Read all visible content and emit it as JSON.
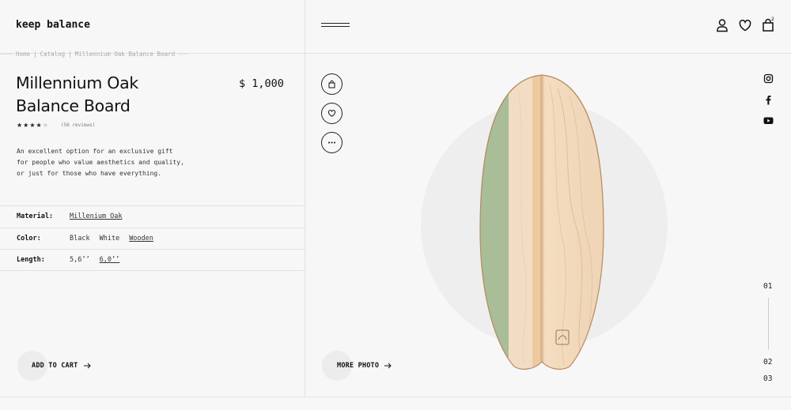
{
  "header": {
    "logo": "keep balance",
    "cart_count": "2",
    "icons": [
      "menu-icon",
      "user-icon",
      "heart-icon",
      "cart-icon"
    ]
  },
  "breadcrumb": {
    "items": [
      "Home",
      "Catalog",
      "Millennium Oak Balance Board"
    ],
    "separator": "|"
  },
  "product": {
    "title": "Millennium Oak Balance Board",
    "price": "$ 1,000",
    "rating": 4,
    "rating_max": 5,
    "reviews": "(56 reviews)",
    "description": [
      "An excellent option for an exclusive gift",
      "for people who value aesthetics and quality,",
      "or just for those who have everything."
    ]
  },
  "attributes": {
    "material": {
      "label": "Material:",
      "options": [
        "Millenium Oak"
      ],
      "selected": "Millenium Oak"
    },
    "color": {
      "label": "Color:",
      "options": [
        "Black",
        "White",
        "Wooden"
      ],
      "selected": "Wooden"
    },
    "length": {
      "label": "Length:",
      "options": [
        "5,6’’",
        "6,0’’"
      ],
      "selected": "6,0’’"
    }
  },
  "actions": {
    "add_to_cart": "ADD TO CART",
    "more_photo": "MORE PHOTO",
    "round_buttons": [
      "bag-icon",
      "heart-icon",
      "more-icon"
    ]
  },
  "social": [
    "instagram-icon",
    "facebook-icon",
    "youtube-icon"
  ],
  "slides": [
    "01",
    "02",
    "03"
  ],
  "colors": {
    "background": "#f7f7f7",
    "text": "#111111",
    "border": "#e2e2e2",
    "board_wood": "#efd3b5",
    "board_green": "#a9bd98"
  }
}
